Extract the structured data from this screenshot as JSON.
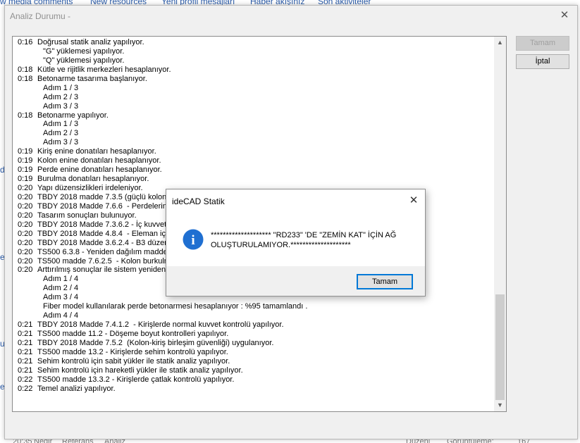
{
  "background": {
    "nav": [
      {
        "label": "w media comments"
      },
      {
        "label": "New resources"
      },
      {
        "label": "Yeni profil mesajları"
      },
      {
        "label": "Haber akışınız"
      },
      {
        "label": "Son aktiviteler"
      }
    ],
    "footer": [
      {
        "label": "20:35"
      },
      {
        "label": "Nedir"
      },
      {
        "label": "Referans"
      },
      {
        "label": "Analiz"
      },
      {
        "label": "Düzenl"
      },
      {
        "label": "Görüntüleme:"
      },
      {
        "label": "167"
      }
    ]
  },
  "dialog": {
    "title": "Analiz Durumu -",
    "close_glyph": "✕",
    "ok_label": "Tamam",
    "cancel_label": "İptal",
    "scroll_up_glyph": "▲",
    "scroll_down_glyph": "▼",
    "log": [
      {
        "time": "0:16",
        "text": "Doğrusal statik analiz yapılıyor."
      },
      {
        "time": "",
        "text": "\"G\" yüklemesi yapılıyor."
      },
      {
        "time": "",
        "text": "\"Q\" yüklemesi yapılıyor."
      },
      {
        "time": "0:18",
        "text": "Kütle ve rijitlik merkezleri hesaplanıyor."
      },
      {
        "time": "0:18",
        "text": "Betonarme tasarıma başlanıyor."
      },
      {
        "time": "",
        "text": "Adım 1 / 3"
      },
      {
        "time": "",
        "text": "Adım 2 / 3"
      },
      {
        "time": "",
        "text": "Adım 3 / 3"
      },
      {
        "time": "0:18",
        "text": "Betonarme yapılıyor."
      },
      {
        "time": "",
        "text": "Adım 1 / 3"
      },
      {
        "time": "",
        "text": "Adım 2 / 3"
      },
      {
        "time": "",
        "text": "Adım 3 / 3"
      },
      {
        "time": "0:19",
        "text": "Kiriş enine donatıları hesaplanıyor."
      },
      {
        "time": "0:19",
        "text": "Kolon enine donatıları hesaplanıyor."
      },
      {
        "time": "0:19",
        "text": "Perde enine donatıları hesaplanıyor."
      },
      {
        "time": "0:19",
        "text": "Burulma donatıları hesaplanıyor."
      },
      {
        "time": "0:20",
        "text": "Yapı düzensizlikleri irdeleniyor."
      },
      {
        "time": "0:20",
        "text": "TBDY 2018 madde 7.3.5 (güçlü kolon k"
      },
      {
        "time": "0:20",
        "text": "TBDY 2018 Madde 7.6.6  - Perdelerin t"
      },
      {
        "time": "0:20",
        "text": "Tasarım sonuçları bulunuyor."
      },
      {
        "time": "0:20",
        "text": "TBDY 2018 Madde 7.3.6.2 - İç kuvvet"
      },
      {
        "time": "0:20",
        "text": "TBDY 2018 Madde 4.8.4  - Eleman iç ku"
      },
      {
        "time": "0:20",
        "text": "TBDY 2018 Madde 3.6.2.4 - B3 düzens"
      },
      {
        "time": "0:20",
        "text": "TS500 6.3.8 - Yeniden dağılım maddesi"
      },
      {
        "time": "0:20",
        "text": "TS500 madde 7.6.2.5  - Kolon burkulm"
      },
      {
        "time": "0:20",
        "text": "Arttırılmış sonuçlar ile sistem yeniden h"
      },
      {
        "time": "",
        "text": "Adım 1 / 4"
      },
      {
        "time": "",
        "text": "Adım 2 / 4"
      },
      {
        "time": "",
        "text": "Adım 3 / 4"
      },
      {
        "time": "",
        "text": "Fiber model kullanılarak perde betonarmesi hesaplanıyor : %95 tamamlandı ."
      },
      {
        "time": "",
        "text": "Adım 4 / 4"
      },
      {
        "time": "0:21",
        "text": "TBDY 2018 Madde 7.4.1.2  - Kirişlerde normal kuvvet kontrolü yapılıyor."
      },
      {
        "time": "0:21",
        "text": "TS500 madde 11.2 - Döşeme boyut kontrolleri yapılıyor."
      },
      {
        "time": "0:21",
        "text": "TBDY 2018 Madde 7.5.2  (Kolon-kiriş birleşim güvenliği) uygulanıyor."
      },
      {
        "time": "0:21",
        "text": "TS500 madde 13.2 - Kirişlerde sehim kontrolü yapılıyor."
      },
      {
        "time": "0:21",
        "text": "Sehim kontrolü için sabit yükler ile statik analiz yapılıyor."
      },
      {
        "time": "0:21",
        "text": "Sehim kontrolü için hareketli yükler ile statik analiz yapılıyor."
      },
      {
        "time": "0:22",
        "text": "TS500 madde 13.3.2 - Kirişlerde çatlak kontrolü yapılıyor."
      },
      {
        "time": "0:22",
        "text": "Temel analizi yapılıyor."
      }
    ]
  },
  "message_box": {
    "title": "ideCAD Statik",
    "close_glyph": "✕",
    "icon": "info-icon",
    "icon_glyph": "i",
    "text": "******************** \"RD233\" 'DE \"ZEMİN KAT\" İÇİN AĞ OLUŞTURULAMIYOR.********************",
    "ok_label": "Tamam"
  },
  "colors": {
    "info_icon": "#1f6fd1",
    "default_button_border": "#0078d7",
    "link": "#2a5ba8"
  }
}
